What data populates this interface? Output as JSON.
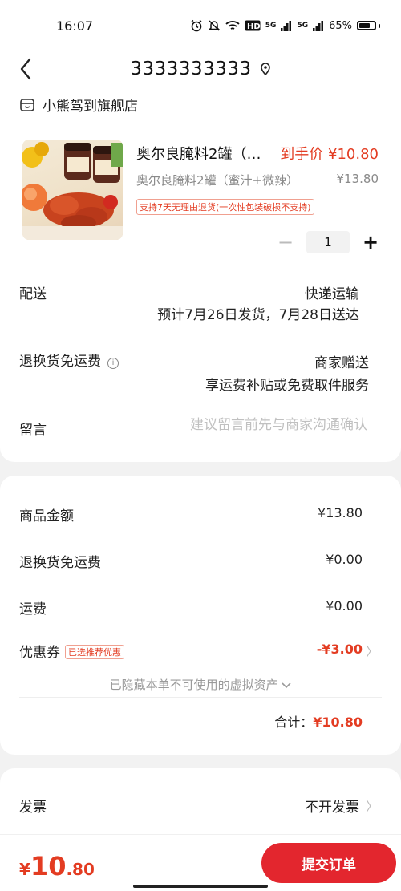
{
  "status_bar": {
    "time": "16:07",
    "network": "5G",
    "network2": "5G",
    "battery": "65%",
    "battery_level": 0.65
  },
  "header": {
    "title": "3333333333"
  },
  "shop": {
    "name": "小熊驾到旗舰店"
  },
  "product": {
    "name": "奥尔良腌料2罐（蜜汁+微辣）",
    "final_price": "到手价 ¥10.80",
    "variant": "奥尔良腌料2罐（蜜汁+微辣）",
    "original_price": "¥13.80",
    "return_policy": "支持7天无理由退货(一次性包装破损不支持)",
    "quantity": "1"
  },
  "delivery": {
    "label": "配送",
    "method": "快递运输",
    "estimate": "预计7月26日发货，7月28日送达"
  },
  "return_shipping": {
    "label": "退换货免运费",
    "value": "商家赠送",
    "detail": "享运费补贴或免费取件服务"
  },
  "message": {
    "label": "留言",
    "placeholder": "建议留言前先与商家沟通确认"
  },
  "summary": {
    "goods_label": "商品金额",
    "goods_value": "¥13.80",
    "return_fee_label": "退换货免运费",
    "return_fee_value": "¥0.00",
    "shipping_label": "运费",
    "shipping_value": "¥0.00",
    "coupon_label": "优惠券",
    "coupon_tag": "已选推荐优惠",
    "coupon_value": "-¥3.00",
    "hidden_assets": "已隐藏本单不可使用的虚拟资产",
    "total_label": "合计：",
    "total_value": "¥10.80"
  },
  "invoice": {
    "label": "发票",
    "value": "不开发票"
  },
  "bottom": {
    "currency": "¥",
    "price_int": "10",
    "price_dec": ".80",
    "submit_label": "提交订单"
  },
  "colors": {
    "accent": "#e33c22",
    "button": "#e3262e"
  }
}
